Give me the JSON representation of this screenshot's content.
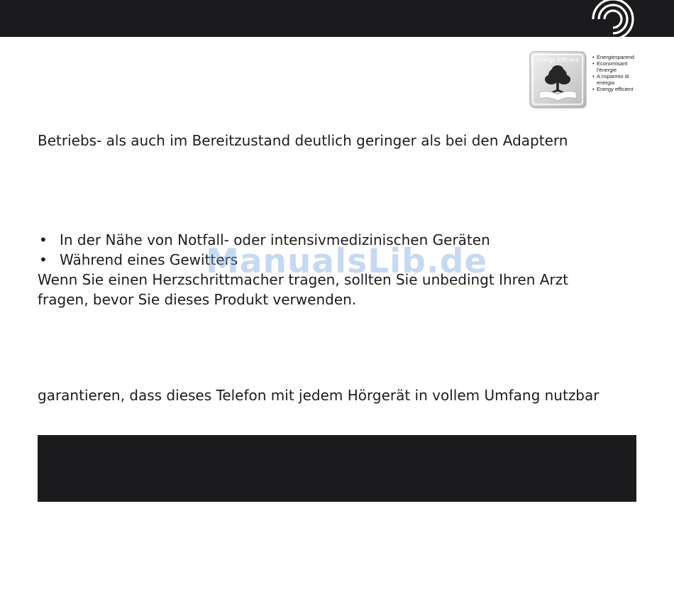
{
  "energy_badge": {
    "badge_label": "Energy Efficient",
    "legend": [
      "Energiesparend",
      "Economisant",
      "l'énergie",
      "A risparmio di",
      "energia",
      "Energy efficient"
    ]
  },
  "content": {
    "line_betriebs": "Betriebs- als auch im Bereitzustand deutlich geringer als bei den Adaptern",
    "bullets": [
      "In der Nähe von Notfall- oder intensivmedizinischen Geräten",
      "Während eines Gewitters"
    ],
    "pacemaker_line1": "Wenn Sie einen Herzschrittmacher tragen, sollten Sie unbedingt Ihren Arzt",
    "pacemaker_line2": "fragen, bevor Sie dieses Produkt verwenden.",
    "line_hoergeraet": "garantieren, dass dieses Telefon mit jedem Hörgerät in vollem Umfang nutzbar"
  },
  "watermark": "ManualsLib.de",
  "colors": {
    "header_bar": "#1b1a1c",
    "text": "#1c1c1e",
    "watermark": "#78a5e1"
  }
}
